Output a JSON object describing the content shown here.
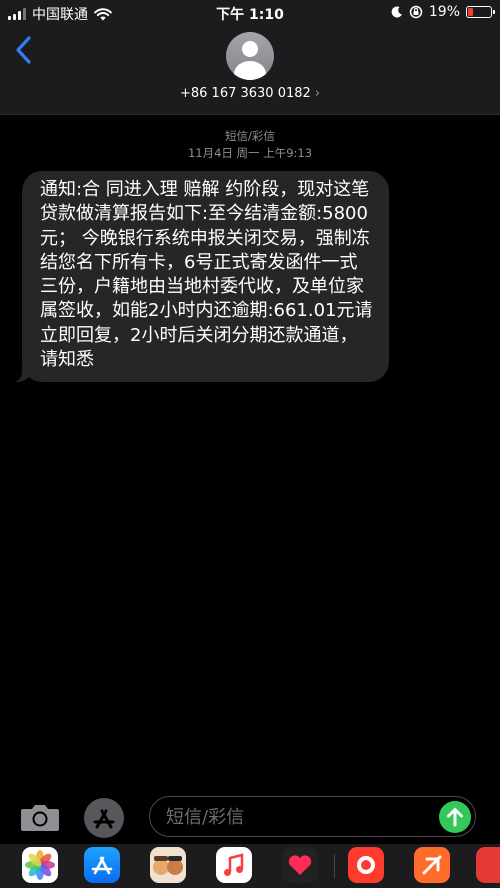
{
  "status_bar": {
    "carrier": "中国联通",
    "time": "下午 1:10",
    "battery_percent": "19%",
    "battery_level": 0.19,
    "battery_color": "#ff3b30"
  },
  "header": {
    "back_icon": "chevron-left-icon",
    "contact_number": "+86 167 3630 0182",
    "contact_chevron": "›"
  },
  "conversation": {
    "service_label": "短信/彩信",
    "timestamp": "11月4日 周一 上午9:13",
    "messages": [
      {
        "direction": "incoming",
        "text": "通知:合 同进入理 赔解 约阶段，现对这笔贷款做清算报告如下:至今结清金额:5800元； 今晚银行系统申报关闭交易，强制冻 结您名下所有卡，6号正式寄发函件一式三份，户籍地由当地村委代收，及单位家属签收，如能2小时内还逾期:661.01元请立即回复，2小时后关闭分期还款通道，请知悉"
      }
    ]
  },
  "composer": {
    "placeholder": "短信/彩信",
    "value": "",
    "camera_icon": "camera-icon",
    "apps_icon": "app-store-icon",
    "send_icon": "send-arrow-icon"
  },
  "app_strip": {
    "apps": [
      "photos-icon",
      "app-store-icon",
      "memoji-icon",
      "music-icon",
      "digital-touch-icon",
      "app-icon",
      "app-icon",
      "app-icon"
    ]
  },
  "colors": {
    "accent": "#2f7cf6",
    "bubble_incoming": "#262629",
    "send_button": "#34c759"
  }
}
